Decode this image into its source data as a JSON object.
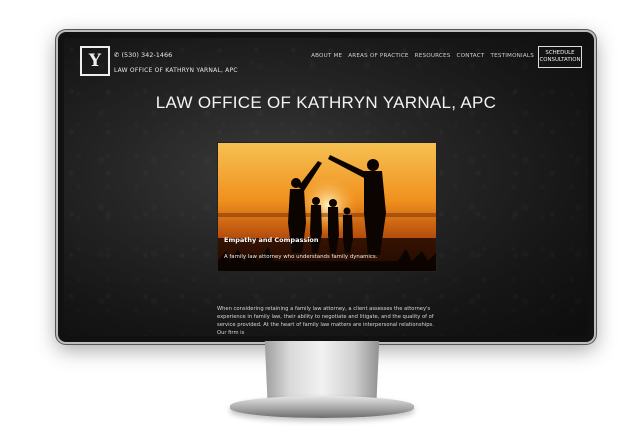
{
  "header": {
    "logo_letter": "Y",
    "phone_icon": "phone-icon",
    "phone": "(530) 342-1466",
    "firm_subtitle": "LAW OFFICE OF KATHRYN YARNAL, APC",
    "nav": [
      "ABOUT ME",
      "AREAS OF PRACTICE",
      "RESOURCES",
      "CONTACT",
      "TESTIMONIALS"
    ],
    "cta_line1": "SCHEDULE",
    "cta_line2": "CONSULTATION"
  },
  "hero": {
    "title": "LAW OFFICE OF KATHRYN YARNAL, APC",
    "card_title": "Empathy and Compassion",
    "card_caption": "A family law attorney who understands family dynamics."
  },
  "content": {
    "paragraph": "When considering retaining a family law attorney, a client assesses the attorney's experience in family law, their ability to negotiate and litigate, and the quality of of service provided. At the heart of family law matters are interpersonal relationships. Our firm is"
  },
  "colors": {
    "background": "#1b1b1b",
    "text": "#f2f2f2",
    "sunset_top": "#f3b040",
    "sunset_bottom": "#6b2a06"
  }
}
